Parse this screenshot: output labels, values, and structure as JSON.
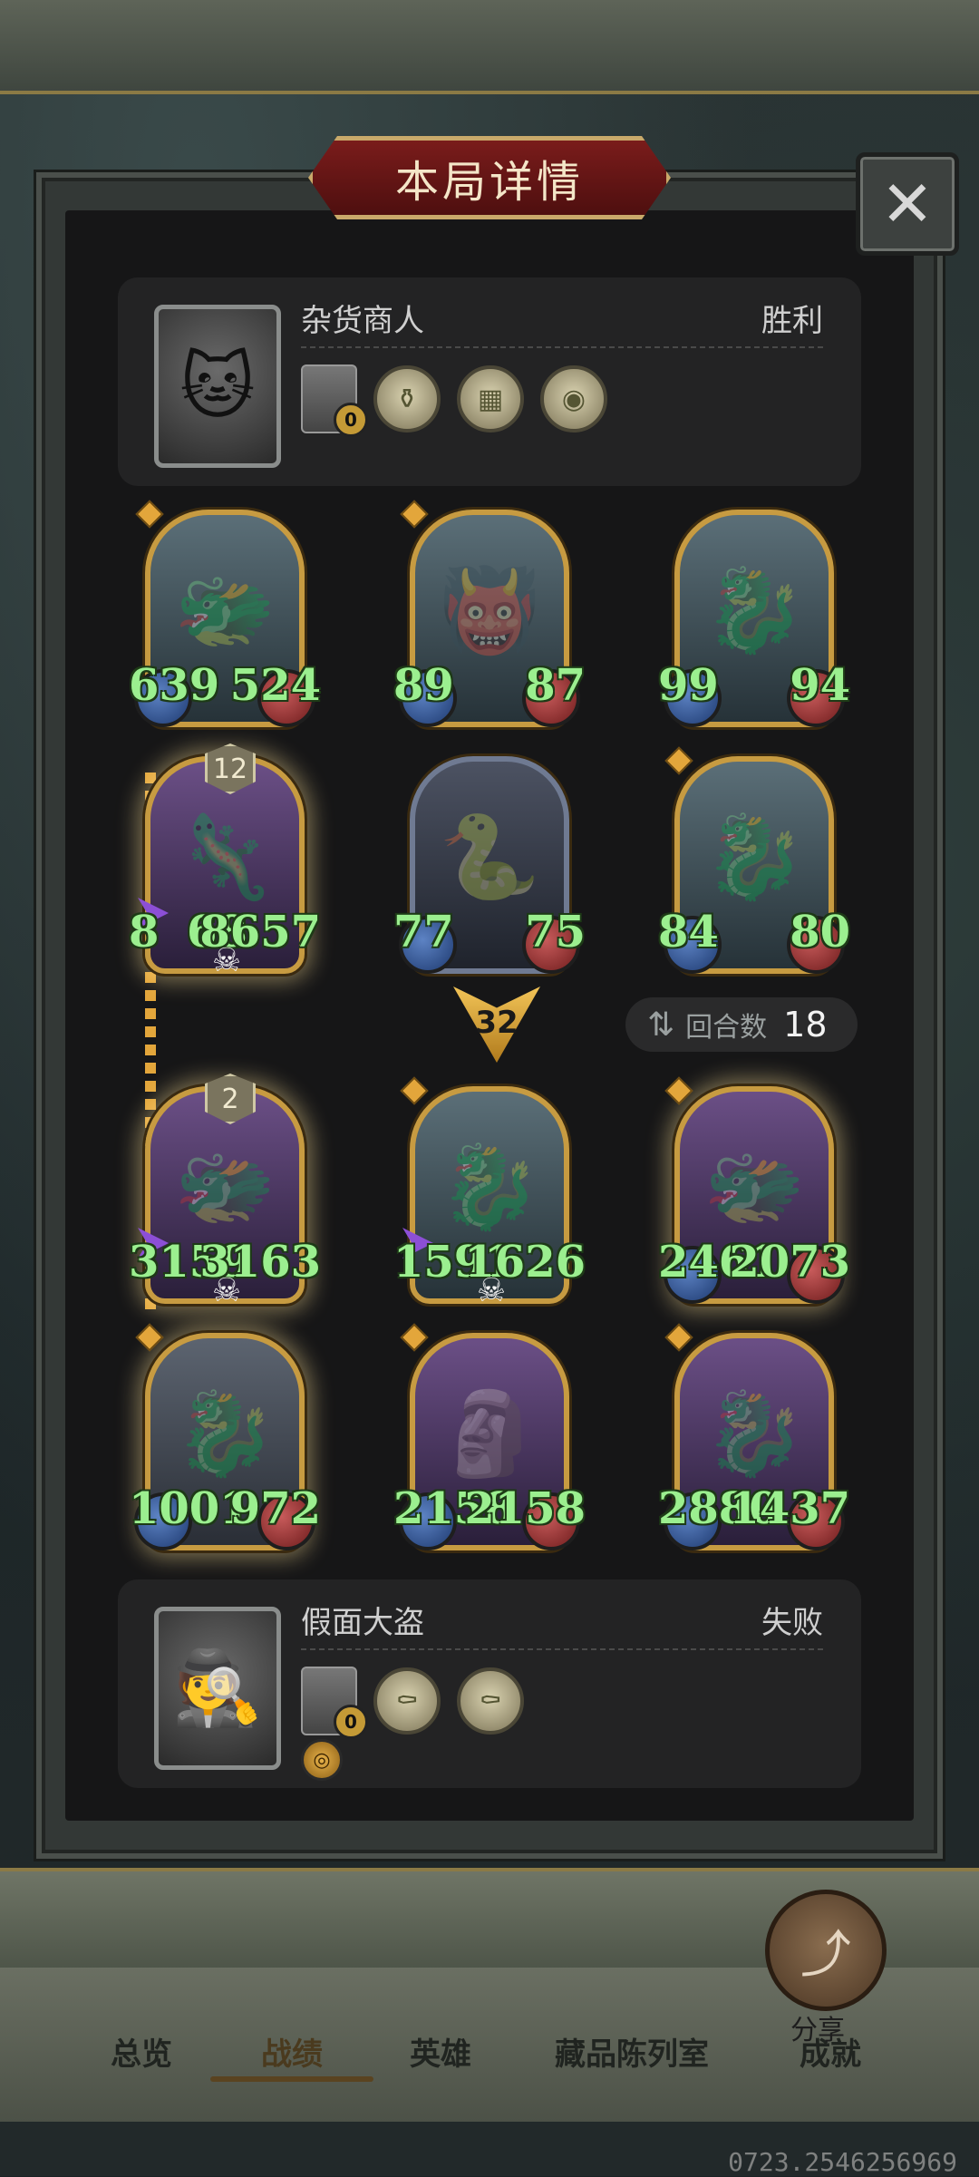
{
  "dialog": {
    "title": "本局详情",
    "close_icon": "close-icon"
  },
  "top_player": {
    "name": "杂货商人",
    "result": "胜利",
    "shop_count": "0",
    "items": [
      "potion-bottle-icon",
      "purple-cabinet-icon",
      "food-plate-icon"
    ]
  },
  "bottom_player": {
    "name": "假面大盗",
    "result": "失败",
    "shop_count": "0",
    "items": [
      "coffin-icon",
      "coffin-icon"
    ],
    "gold_badge_icon": "gold-coin-icon"
  },
  "top_units": [
    {
      "atk": "639",
      "hp": "524"
    },
    {
      "atk": "89",
      "hp": "87"
    },
    {
      "atk": "99",
      "hp": "94"
    },
    {
      "atk": "8",
      "hp": "8657",
      "extra": "68",
      "level": "12"
    },
    {
      "atk": "77",
      "hp": "75"
    },
    {
      "atk": "84",
      "hp": "80"
    }
  ],
  "bottom_units": [
    {
      "atk": "3159",
      "hp": "3163",
      "level": "2"
    },
    {
      "atk": "1591",
      "hp": "1626"
    },
    {
      "atk": "2461",
      "hp": "2073"
    },
    {
      "atk": "1001",
      "hp": "972"
    },
    {
      "atk": "2158",
      "hp": "2158"
    },
    {
      "atk": "2880",
      "hp": "1437"
    }
  ],
  "attack_marker": "32",
  "rounds": {
    "label": "回合数",
    "value": "18"
  },
  "share": {
    "label": "分享"
  },
  "tabs": [
    "总览",
    "战绩",
    "英雄",
    "藏品陈列室",
    "成就"
  ],
  "active_tab": "战绩",
  "footer_id": "0723.2546256969"
}
